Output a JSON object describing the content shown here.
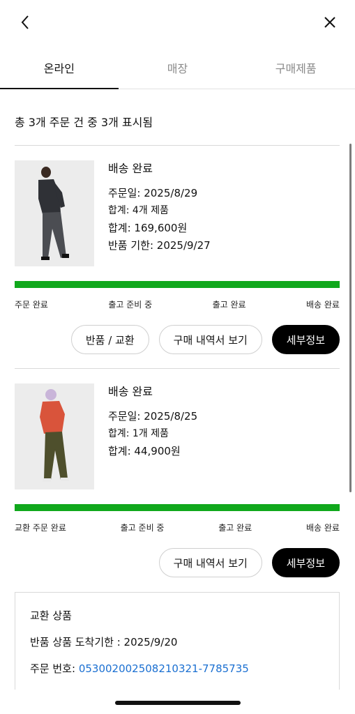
{
  "tabs": [
    {
      "label": "온라인",
      "active": true
    },
    {
      "label": "매장",
      "active": false
    },
    {
      "label": "구매제품",
      "active": false
    }
  ],
  "summary": "총 3개 주문 건 중 3개 표시됨",
  "orders": [
    {
      "status": "배송 완료",
      "order_date": "주문일: 2025/8/29",
      "items": "합계: 4개 제품",
      "total": "합계: 169,600원",
      "return_deadline": "반품 기한: 2025/9/27",
      "progress_fraction": 1.0,
      "steps": [
        "주문 완료",
        "출고 준비 중",
        "출고 완료",
        "배송 완료"
      ],
      "buttons": [
        "반품 / 교환",
        "구매 내역서 보기",
        "세부정보"
      ]
    },
    {
      "status": "배송 완료",
      "order_date": "주문일: 2025/8/25",
      "items": "합계: 1개 제품",
      "total": "합계: 44,900원",
      "progress_fraction": 1.0,
      "steps": [
        "교환 주문 완료",
        "출고 준비 중",
        "출고 완료",
        "배송 완료"
      ],
      "buttons": [
        "구매 내역서 보기",
        "세부정보"
      ]
    }
  ],
  "exchange": {
    "title": "교환 상품",
    "deadline": "반품 상품 도착기한 : 2025/9/20",
    "order_label": "주문 번호:",
    "order_number": "053002002508210321-7785735"
  },
  "colors": {
    "progress": "#10a81c",
    "link": "#1a6fd1",
    "primary_button": "#000000"
  }
}
